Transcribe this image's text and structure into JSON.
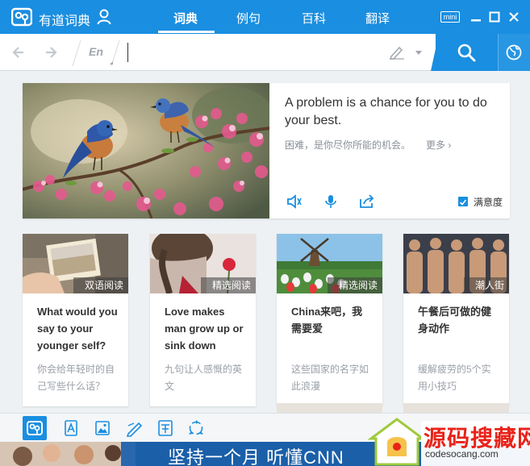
{
  "titlebar": {
    "app_name": "有道词典",
    "tabs": [
      {
        "label": "词典",
        "active": true
      },
      {
        "label": "例句",
        "active": false
      },
      {
        "label": "百科",
        "active": false
      },
      {
        "label": "翻译",
        "active": false
      }
    ],
    "mini_label": "mini",
    "accent": "#1a8ee0"
  },
  "searchbar": {
    "language": "En",
    "input_value": "",
    "icons": [
      "back-arrow-icon",
      "forward-arrow-icon",
      "handwriting-pen-icon",
      "search-icon",
      "globe-icon"
    ]
  },
  "feature": {
    "sentence": "A problem is a chance for you to do your best.",
    "translation": "困难，是你尽你所能的机会。",
    "more_label": "更多",
    "satisfaction_label": "满意度"
  },
  "cards": [
    {
      "tag": "双语阅读",
      "title": "What would you say to your younger self?",
      "desc": "你会给年轻时的自己写些什么话？"
    },
    {
      "tag": "精选阅读",
      "title": "Love makes man grow up or sink down",
      "desc": "九句让人感慨的英文"
    },
    {
      "tag": "精选阅读",
      "title": "China来吧，我需要爱",
      "desc": "这些国家的名字如此浪漫"
    },
    {
      "tag": "潮人街",
      "title": "午餐后可做的健身动作",
      "desc": "缓解疲劳的5个实用小技巧"
    }
  ],
  "ad": {
    "text": "坚持一个月 听懂CNN"
  },
  "watermark": {
    "title": "源码搜藏网",
    "url": "codesocang.com"
  }
}
